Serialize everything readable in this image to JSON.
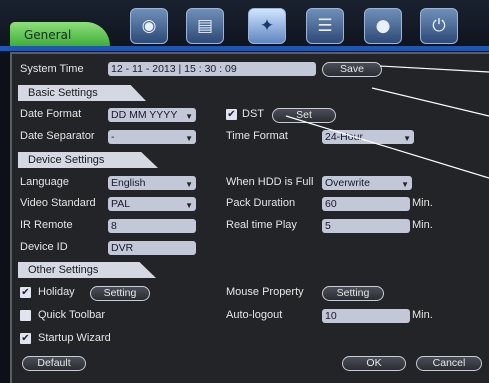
{
  "tabs": {
    "general_label": "General"
  },
  "toolbar_icons": [
    "camera-icon",
    "network-icon",
    "wrench-icon",
    "list-icon",
    "record-icon",
    "power-icon"
  ],
  "system_time": {
    "label": "System Time",
    "value": "12 - 11 - 2013   | 15 : 30 : 09",
    "save_label": "Save"
  },
  "basic": {
    "title": "Basic Settings",
    "date_format_label": "Date Format",
    "date_format_value": "DD MM YYYY",
    "dst_label": "DST",
    "dst_set_label": "Set",
    "date_separator_label": "Date Separator",
    "date_separator_value": "-",
    "time_format_label": "Time Format",
    "time_format_value": "24-Hour"
  },
  "device": {
    "title": "Device Settings",
    "language_label": "Language",
    "language_value": "English",
    "hdd_full_label": "When HDD is Full",
    "hdd_full_value": "Overwrite",
    "video_standard_label": "Video Standard",
    "video_standard_value": "PAL",
    "pack_duration_label": "Pack Duration",
    "pack_duration_value": "60",
    "pack_duration_unit": "Min.",
    "ir_remote_label": "IR Remote",
    "ir_remote_value": "8",
    "realtime_play_label": "Real time Play",
    "realtime_play_value": "5",
    "realtime_play_unit": "Min.",
    "device_id_label": "Device ID",
    "device_id_value": "DVR"
  },
  "other": {
    "title": "Other Settings",
    "holiday_label": "Holiday",
    "holiday_setting_label": "Setting",
    "mouse_property_label": "Mouse Property",
    "mouse_setting_label": "Setting",
    "quick_toolbar_label": "Quick Toolbar",
    "auto_logout_label": "Auto-logout",
    "auto_logout_value": "10",
    "auto_logout_unit": "Min.",
    "startup_wizard_label": "Startup Wizard"
  },
  "footer": {
    "default_label": "Default",
    "ok_label": "OK",
    "cancel_label": "Cancel"
  },
  "checkboxes": {
    "dst": true,
    "holiday": true,
    "quick_toolbar": false,
    "startup_wizard": true
  },
  "colors": {
    "accent_green": "#3fae3a",
    "panel": "#232427",
    "field": "#c2c8d8",
    "bluebar": "#1e56b0"
  }
}
